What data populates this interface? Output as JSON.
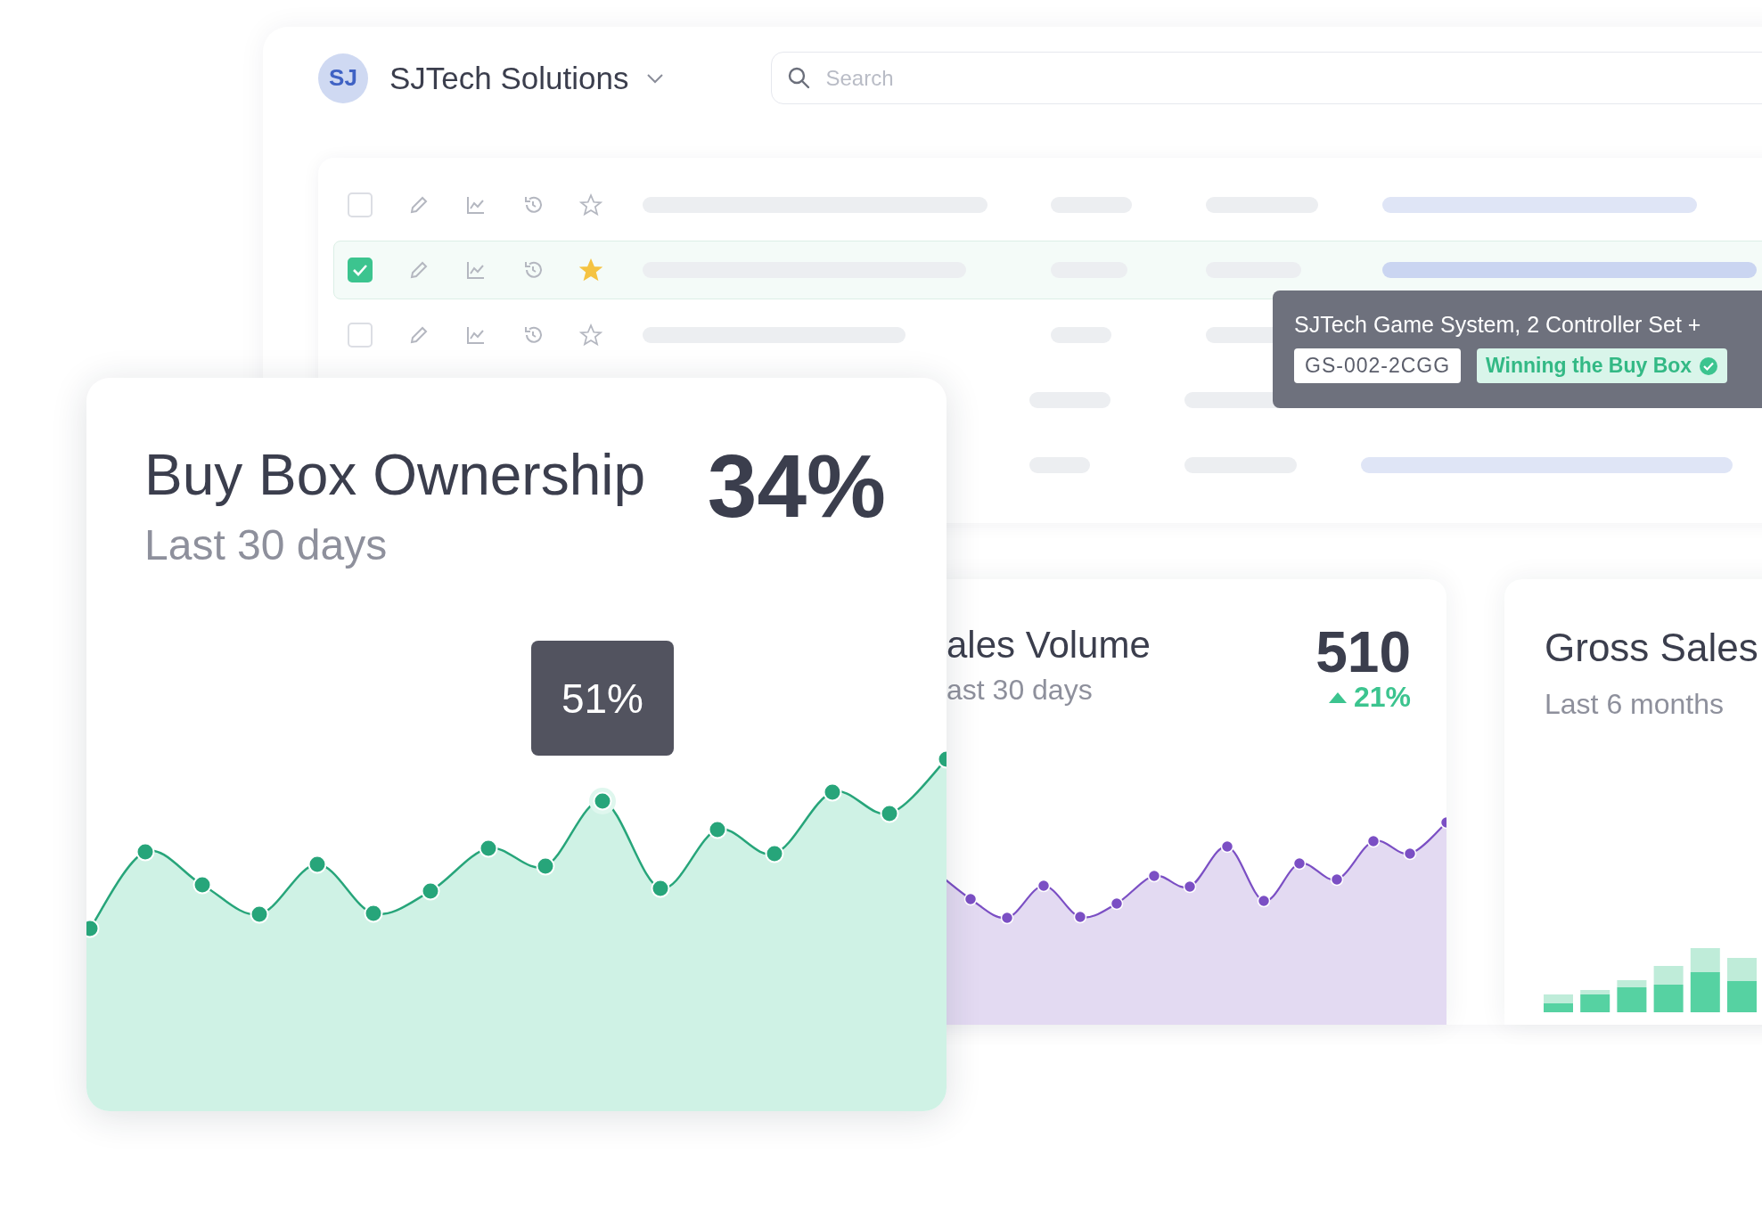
{
  "header": {
    "avatar": "SJ",
    "company": "SJTech Solutions",
    "search": {
      "placeholder": "Search"
    }
  },
  "rows": [
    {
      "checked": false,
      "starred": false
    },
    {
      "checked": true,
      "starred": true
    },
    {
      "checked": false,
      "starred": false
    },
    {},
    {}
  ],
  "product_tooltip": {
    "title": "SJTech Game System, 2 Controller Set +",
    "sku": "GS-002-2CGG",
    "status": "Winning the Buy Box"
  },
  "buy_box_card": {
    "title": "Buy Box Ownership",
    "subtitle": "Last 30 days",
    "value": "34%",
    "tooltip": "51%"
  },
  "sales_volume_card": {
    "title": "ales Volume",
    "subtitle": "ast 30 days",
    "value": "510",
    "change": "21%"
  },
  "gross_sales_card": {
    "title": "Gross Sales",
    "subtitle": "Last 6 months"
  }
}
